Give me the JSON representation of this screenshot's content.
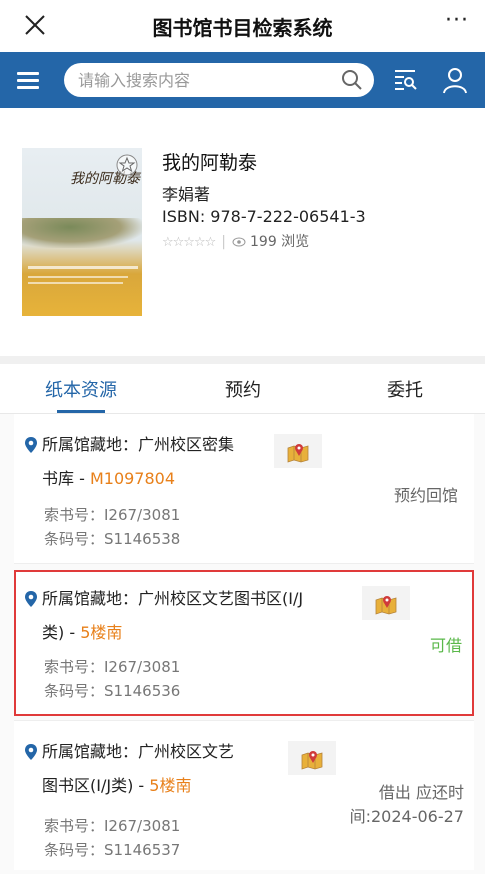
{
  "titlebar": {
    "title": "图书馆书目检索系统",
    "close_icon": "close-icon",
    "more_label": "···"
  },
  "searchbar": {
    "placeholder": "请输入搜索内容",
    "value": "",
    "icons": [
      "menu-icon",
      "search-icon",
      "scan-icon",
      "user-icon"
    ],
    "background": "#2466a8"
  },
  "book": {
    "title": "我的阿勒泰",
    "cover_title": "我的阿勒泰",
    "author": "李娟著",
    "isbn": "ISBN: 978-7-222-06541-3",
    "rating_stars": "☆☆☆☆☆",
    "rating": 0,
    "views": "199 浏览"
  },
  "tabs": [
    {
      "label": "纸本资源",
      "active": true
    },
    {
      "label": "预约",
      "active": false
    },
    {
      "label": "委托",
      "active": false
    }
  ],
  "holdings": [
    {
      "location_line1": "所属馆藏地：广州校区密集",
      "location_line2": "书库 - ",
      "location_code": "M1097804",
      "call_number": "索书号：I267/3081",
      "barcode": "条码号：S1146538",
      "status": "预约回馆"
    },
    {
      "location_line1": "所属馆藏地：广州校区文艺图书区(I/J",
      "location_line2": "类) - ",
      "location_code": "5楼南",
      "call_number": "索书号：I267/3081",
      "barcode": "条码号：S1146536",
      "status": "可借"
    },
    {
      "location_line1": "所属馆藏地：广州校区文艺",
      "location_line2": "图书区(I/J类) - ",
      "location_code": "5楼南",
      "call_number": "索书号：I267/3081",
      "barcode": "条码号：S1146537",
      "status_line1": "借出 应还时",
      "status_line2": "间:2024-06-27"
    }
  ],
  "colors": {
    "accent": "#2466a8",
    "code": "#e8801a",
    "available": "#5ab84a",
    "highlight_border": "#e03a3a"
  }
}
